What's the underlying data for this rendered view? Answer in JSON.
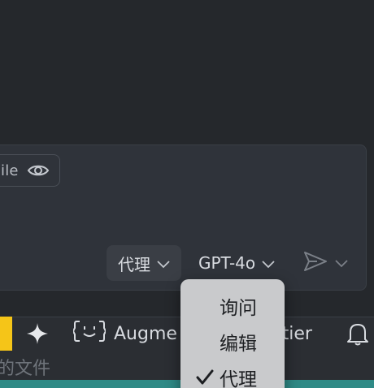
{
  "input": {
    "file_chip_text": "ile",
    "mode_label": "代理",
    "model_label": "GPT-4o"
  },
  "status_bar": {
    "augment_label": "Augme",
    "prettier_label": "ttier"
  },
  "lower": {
    "text": "的文件"
  },
  "menu": {
    "items": [
      {
        "label": "询问",
        "checked": false
      },
      {
        "label": "编辑",
        "checked": false
      },
      {
        "label": "代理",
        "checked": true
      }
    ]
  },
  "icons": {
    "eye": "eye-icon",
    "mode_chevron": "chevron-down-icon",
    "model_chevron": "chevron-down-icon",
    "send": "send-icon",
    "sparkle": "sparkle-icon",
    "augment": "augment-face-icon",
    "bell": "bell-icon",
    "check": "check-icon"
  },
  "colors": {
    "background": "#25282c",
    "panel": "#2f333a",
    "menu": "#c9cacc",
    "status_accent": "#f5c518",
    "bottom_strip": "#2f8a86"
  }
}
